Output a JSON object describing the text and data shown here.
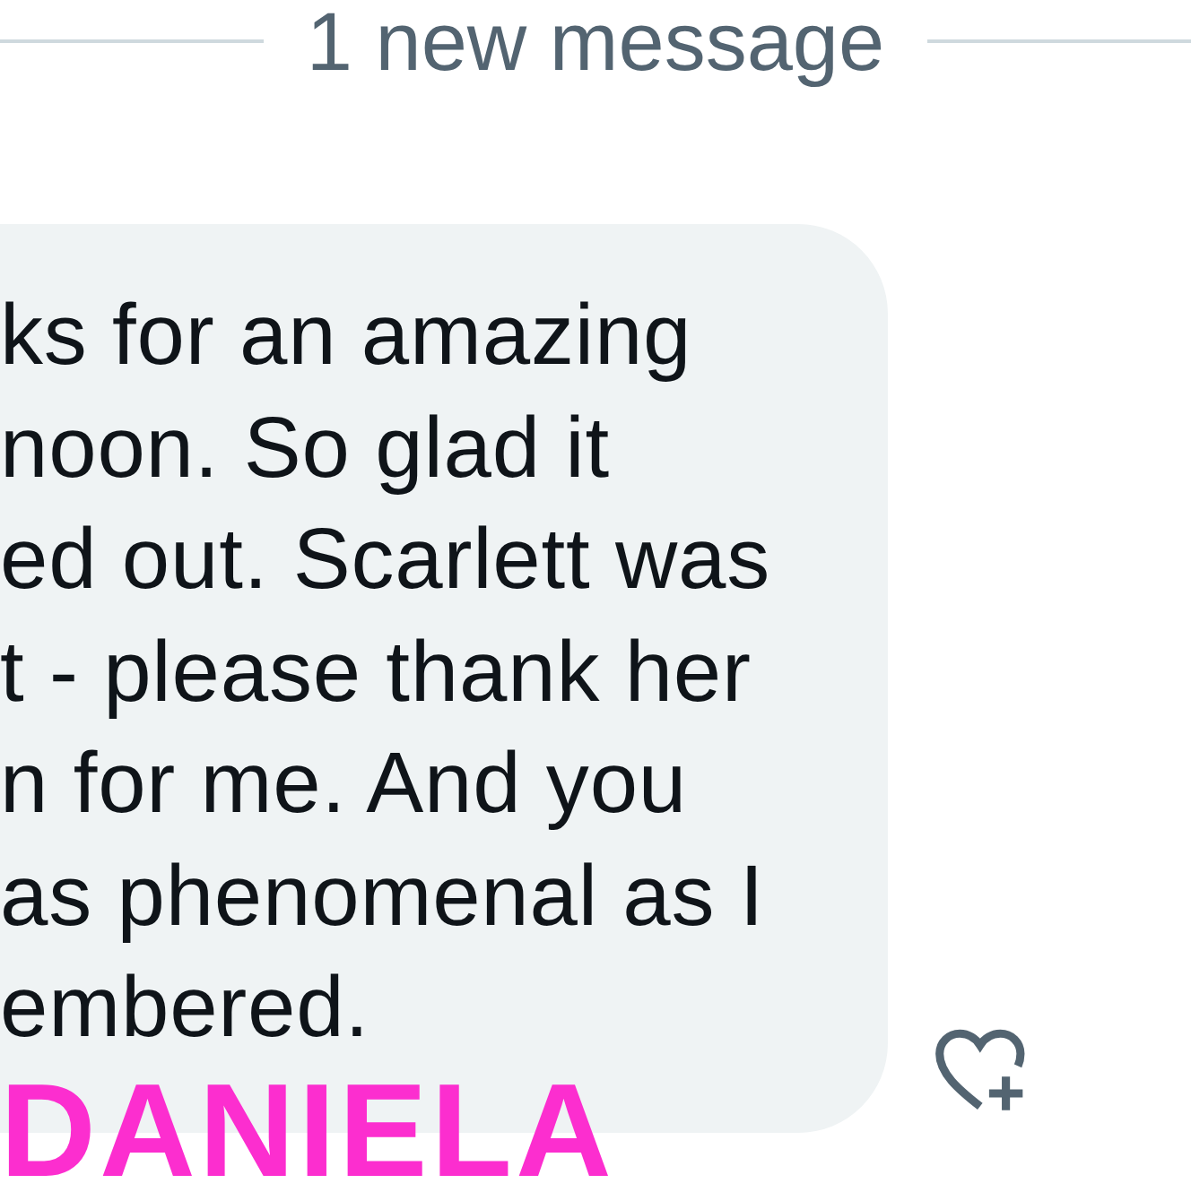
{
  "divider": {
    "label": "1 new message"
  },
  "message": {
    "lines": [
      "ks for an amazing",
      "noon. So glad it",
      "ed out. Scarlett was",
      "t - please thank her",
      "n for me. And you",
      "as phenomenal as I",
      "embered."
    ]
  },
  "caption": "DANIELA"
}
